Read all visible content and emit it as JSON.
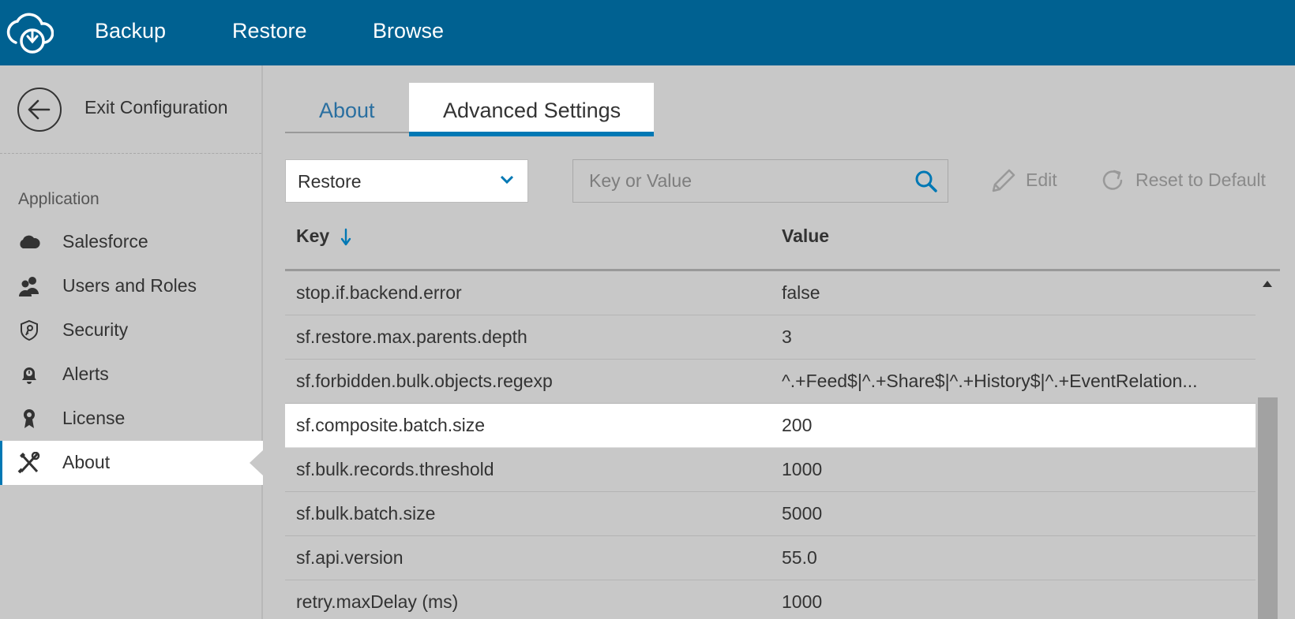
{
  "topnav": {
    "items": [
      {
        "label": "Backup"
      },
      {
        "label": "Restore"
      },
      {
        "label": "Browse"
      }
    ]
  },
  "sidebar": {
    "exit_label": "Exit Configuration",
    "section_label": "Application",
    "items": [
      {
        "label": "Salesforce",
        "icon": "cloud-icon"
      },
      {
        "label": "Users and Roles",
        "icon": "users-icon"
      },
      {
        "label": "Security",
        "icon": "shield-key-icon"
      },
      {
        "label": "Alerts",
        "icon": "bell-alert-icon"
      },
      {
        "label": "License",
        "icon": "award-icon"
      },
      {
        "label": "About",
        "icon": "tools-icon",
        "active": true
      }
    ]
  },
  "tabs": [
    {
      "label": "About"
    },
    {
      "label": "Advanced Settings",
      "active": true
    }
  ],
  "toolbar": {
    "select_value": "Restore",
    "search_placeholder": "Key or Value",
    "edit_label": "Edit",
    "reset_label": "Reset to Default"
  },
  "table": {
    "headers": {
      "key": "Key",
      "value": "Value"
    },
    "rows": [
      {
        "key": "stop.if.backend.error",
        "value": "false"
      },
      {
        "key": "sf.restore.max.parents.depth",
        "value": "3"
      },
      {
        "key": "sf.forbidden.bulk.objects.regexp",
        "value": "^.+Feed$|^.+Share$|^.+History$|^.+EventRelation..."
      },
      {
        "key": "sf.composite.batch.size",
        "value": "200",
        "selected": true
      },
      {
        "key": "sf.bulk.records.threshold",
        "value": "1000"
      },
      {
        "key": "sf.bulk.batch.size",
        "value": "5000"
      },
      {
        "key": "sf.api.version",
        "value": "55.0"
      },
      {
        "key": "retry.maxDelay (ms)",
        "value": "1000"
      }
    ]
  },
  "colors": {
    "topbar": "#006191",
    "accent": "#0078b4",
    "background": "#c8c8c8"
  }
}
